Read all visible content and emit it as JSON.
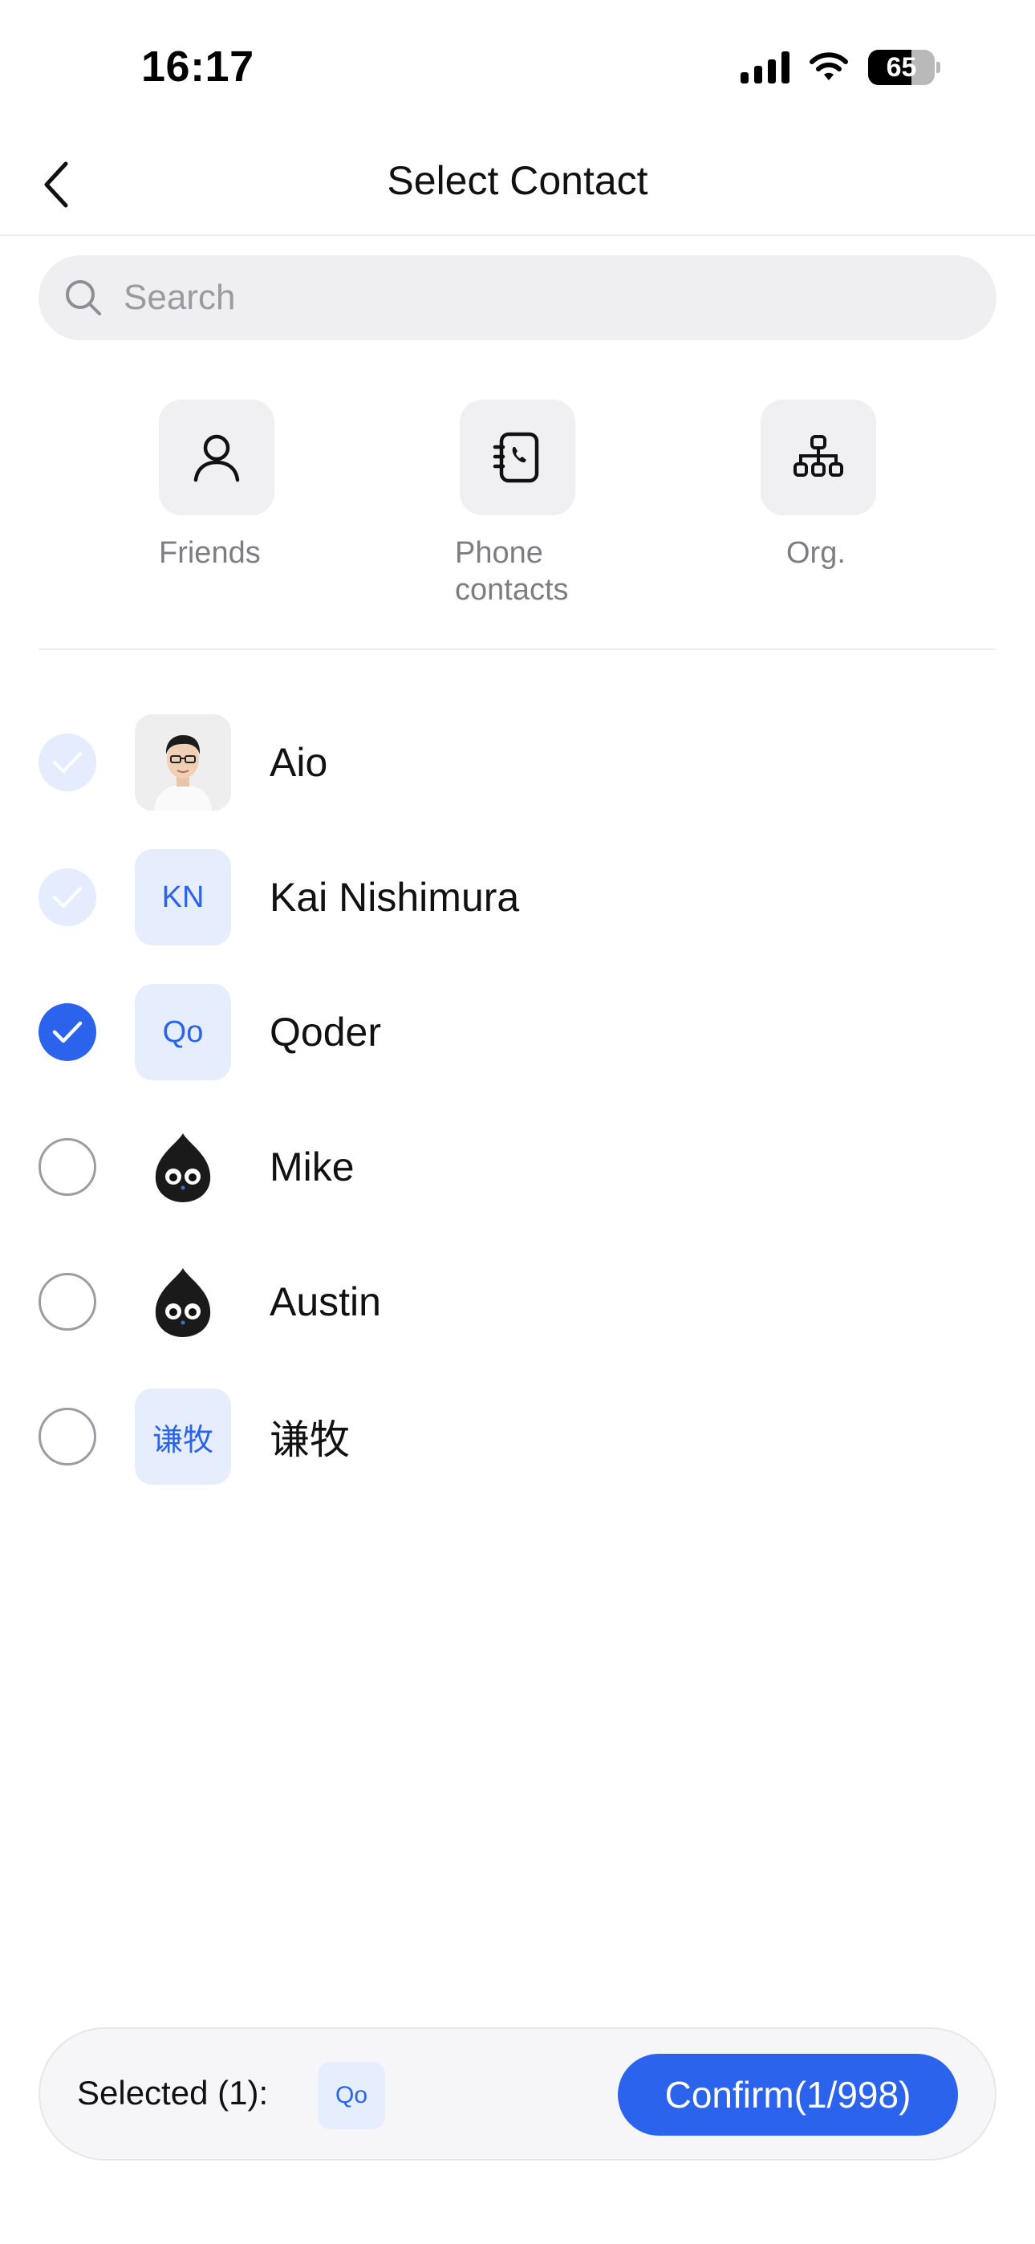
{
  "status_bar": {
    "time": "16:17",
    "battery": "65",
    "icons": [
      "cellular-signal-icon",
      "wifi-icon",
      "battery-icon"
    ]
  },
  "nav": {
    "title": "Select Contact",
    "back_icon": "chevron-left-icon"
  },
  "search": {
    "placeholder": "Search",
    "icon": "search-icon"
  },
  "categories": [
    {
      "label": "Friends",
      "icon": "person-icon"
    },
    {
      "label": "Phone contacts",
      "icon": "phone-book-icon"
    },
    {
      "label": "Org.",
      "icon": "org-chart-icon"
    }
  ],
  "contacts": [
    {
      "name": "Aio",
      "avatar_type": "photo",
      "avatar_text": "",
      "state": "preselected"
    },
    {
      "name": "Kai Nishimura",
      "avatar_type": "initials",
      "avatar_text": "KN",
      "state": "preselected"
    },
    {
      "name": "Qoder",
      "avatar_type": "initials",
      "avatar_text": "Qo",
      "state": "checked"
    },
    {
      "name": "Mike",
      "avatar_type": "mascot",
      "avatar_text": "",
      "state": "unchecked"
    },
    {
      "name": "Austin",
      "avatar_type": "mascot",
      "avatar_text": "",
      "state": "unchecked"
    },
    {
      "name": "谦牧",
      "avatar_type": "initials",
      "avatar_text": "谦牧",
      "state": "unchecked"
    }
  ],
  "bottom_bar": {
    "selected_label": "Selected (1):",
    "selected_chip": "Qo",
    "confirm_label": "Confirm(1/998)"
  },
  "colors": {
    "accent": "#2b63ed",
    "accent_light": "#e6eefd",
    "check_locked": "#e4ecfd",
    "text_secondary": "#7d7d84"
  }
}
